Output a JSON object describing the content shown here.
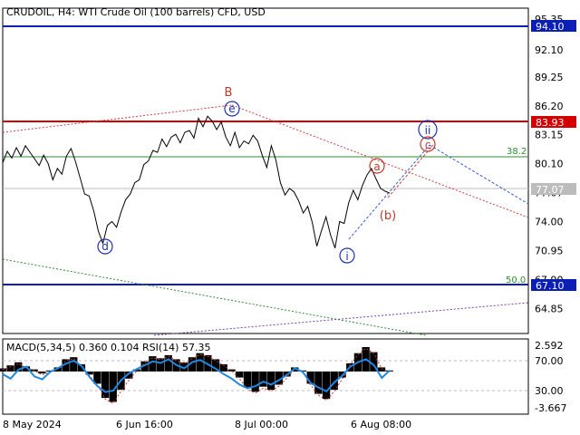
{
  "header": {
    "title": "CRUDOIL, H4:  WTI Crude Oil (100 barrels) CFD, USD"
  },
  "chart_data": [
    {
      "type": "line",
      "name": "price",
      "title": "CRUDOIL, H4:  WTI Crude Oil (100 barrels) CFD, USD",
      "ylim": [
        62.2,
        96.5
      ],
      "y_ticks": [
        "95.35",
        "92.10",
        "89.25",
        "86.20",
        "83.15",
        "80.10",
        "77.07",
        "74.00",
        "70.95",
        "67.90",
        "64.85"
      ],
      "x_ticks": [
        "8 May 2024",
        "6 Jun 16:00",
        "8 Jul 00:00",
        "6 Aug 08:00"
      ],
      "series": [
        {
          "values": [
            80.2,
            81.4,
            80.7,
            81.8,
            80.9,
            82.0,
            81.3,
            80.6,
            79.9,
            81.0,
            80.1,
            78.4,
            79.6,
            79.0,
            80.9,
            81.7,
            80.3,
            78.6,
            76.9,
            76.7,
            75.1,
            73.0,
            71.7,
            73.6,
            74.0,
            73.4,
            75.0,
            76.3,
            76.9,
            78.1,
            78.4,
            80.0,
            80.4,
            81.5,
            81.3,
            82.7,
            81.9,
            82.9,
            83.2,
            82.3,
            83.4,
            83.6,
            82.8,
            84.9,
            84.0,
            85.1,
            84.6,
            83.7,
            84.5,
            82.9,
            82.0,
            83.4,
            81.8,
            82.5,
            82.2,
            83.1,
            82.5,
            81.0,
            79.7,
            82.0,
            80.5,
            78.1,
            76.8,
            77.5,
            77.1,
            76.2,
            74.9,
            75.6,
            73.9,
            71.4,
            73.0,
            74.5,
            72.6,
            71.2,
            74.0,
            73.8,
            76.0,
            77.3,
            76.3,
            77.8,
            78.9,
            79.6,
            78.5,
            77.5,
            77.2,
            77.0
          ]
        }
      ],
      "levels": [
        {
          "value": "94.10",
          "color": "#0b1fb5"
        },
        {
          "value": "83.93",
          "color": "#d40000"
        },
        {
          "value": "67.10",
          "color": "#0b1fb5"
        },
        {
          "value": "77.07",
          "color": "#b9b9b9"
        }
      ],
      "fib_levels": [
        {
          "label": "38.2",
          "value": 80.4
        },
        {
          "label": "50.0",
          "value": 67.4
        }
      ],
      "wave_labels": {
        "B": "B",
        "e": "e",
        "d": "d",
        "i": "i",
        "ii": "ii",
        "a": "a",
        "b": "(b)",
        "c": "c"
      }
    },
    {
      "type": "line",
      "name": "indicator",
      "title": "MACD(5,34,5) 0.360 0.104 RSI(14) 57.35",
      "ylim": [
        -4.2,
        3.2
      ],
      "y_ticks": [
        "2.592",
        "70.00",
        "30.00",
        "-3.667"
      ],
      "series": [
        {
          "name": "MACD",
          "values": [
            0.3,
            0.6,
            0.9,
            0.5,
            0.2,
            -0.2,
            0.1,
            0.4,
            1.2,
            1.4,
            0.7,
            -0.3,
            -1.2,
            -2.6,
            -3.0,
            -1.8,
            -0.7,
            0.2,
            1.0,
            1.5,
            1.3,
            1.6,
            1.2,
            0.9,
            1.4,
            1.8,
            1.6,
            1.2,
            0.7,
            0.2,
            -0.6,
            -1.6,
            -2.0,
            -1.5,
            -1.8,
            -1.3,
            -0.5,
            0.4,
            0.1,
            -1.2,
            -2.2,
            -2.7,
            -1.8,
            -0.6,
            0.8,
            1.8,
            2.4,
            1.9,
            0.4,
            0.1
          ]
        },
        {
          "name": "RSI",
          "values": [
            52,
            46,
            58,
            62,
            49,
            45,
            55,
            60,
            66,
            70,
            63,
            48,
            36,
            28,
            30,
            44,
            53,
            59,
            64,
            69,
            67,
            72,
            64,
            60,
            68,
            71,
            65,
            59,
            52,
            46,
            38,
            33,
            36,
            42,
            38,
            44,
            51,
            60,
            55,
            40,
            34,
            29,
            41,
            50,
            62,
            68,
            72,
            64,
            47,
            57
          ]
        }
      ]
    }
  ]
}
